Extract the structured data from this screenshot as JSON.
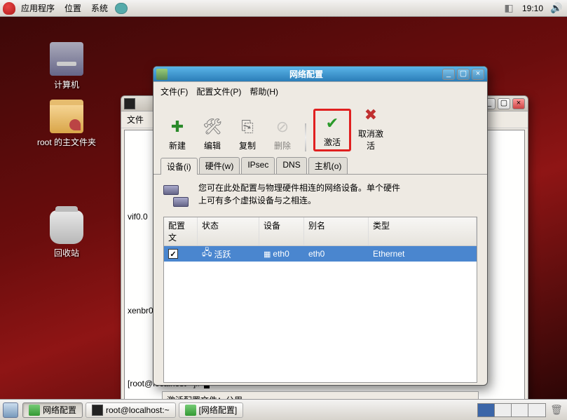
{
  "top_panel": {
    "menus": {
      "apps": "应用程序",
      "places": "位置",
      "system": "系统"
    },
    "clock": "19:10"
  },
  "desktop_icons": {
    "computer": "计算机",
    "home": "root 的主文件夹",
    "trash": "回收站"
  },
  "terminal": {
    "menu": {
      "file": "文件"
    },
    "lines": {
      "vif": "vif0.0",
      "xenbr": "xenbr0"
    },
    "prompt": "[root@localhost ~]# "
  },
  "netcfg": {
    "title": "网络配置",
    "menus": {
      "file": "文件(F)",
      "profile": "配置文件(P)",
      "help": "帮助(H)"
    },
    "toolbar": {
      "new": "新建",
      "edit": "编辑",
      "copy": "复制",
      "delete": "删除",
      "activate": "激活",
      "deactivate": "取消激活"
    },
    "tabs": {
      "devices": "设备(i)",
      "hardware": "硬件(w)",
      "ipsec": "IPsec",
      "dns": "DNS",
      "hosts": "主机(o)"
    },
    "info": {
      "line1": "您可在此处配置与物理硬件相连的网络设备。单个硬件",
      "line2": "上可有多个虚拟设备与之相连。"
    },
    "columns": {
      "cfg": "配置文",
      "status": "状态",
      "device": "设备",
      "alias": "别名",
      "type": "类型"
    },
    "row": {
      "status": "活跃",
      "device": "eth0",
      "alias": "eth0",
      "type": "Ethernet"
    },
    "status_bar": "激活配置文件：公用"
  },
  "bottom_panel": {
    "task1": "网络配置",
    "task2": "root@localhost:~",
    "task3": "[网络配置]"
  }
}
